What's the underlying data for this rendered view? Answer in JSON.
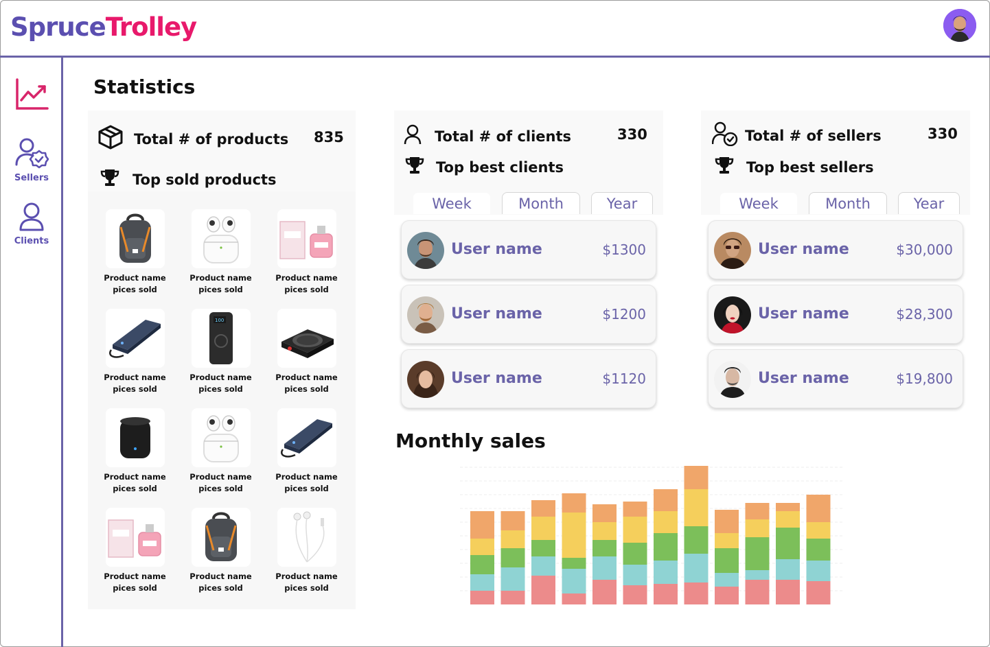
{
  "app": {
    "logo_part1": "Spruce",
    "logo_part2": "Trolley"
  },
  "sidebar": {
    "items": [
      {
        "label": "",
        "icon": "chart-line-icon"
      },
      {
        "label": "Sellers",
        "icon": "sellers-icon"
      },
      {
        "label": "Clients",
        "icon": "clients-icon"
      }
    ]
  },
  "page": {
    "title": "Statistics"
  },
  "products": {
    "total_label": "Total # of products",
    "total_value": "835",
    "top_label": "Top sold products",
    "items": [
      {
        "name": "Product name",
        "sold": "pices sold",
        "image": "backpack"
      },
      {
        "name": "Product name",
        "sold": "pices sold",
        "image": "earbuds"
      },
      {
        "name": "Product name",
        "sold": "pices sold",
        "image": "perfume"
      },
      {
        "name": "Product name",
        "sold": "pices sold",
        "image": "powerbank-slim"
      },
      {
        "name": "Product name",
        "sold": "pices sold",
        "image": "powerbank"
      },
      {
        "name": "Product name",
        "sold": "pices sold",
        "image": "hotplate"
      },
      {
        "name": "Product name",
        "sold": "pices sold",
        "image": "smart-hub"
      },
      {
        "name": "Product name",
        "sold": "pices sold",
        "image": "earbuds"
      },
      {
        "name": "Product name",
        "sold": "pices sold",
        "image": "powerbank-slim"
      },
      {
        "name": "Product name",
        "sold": "pices sold",
        "image": "perfume"
      },
      {
        "name": "Product name",
        "sold": "pices sold",
        "image": "backpack"
      },
      {
        "name": "Product name",
        "sold": "pices sold",
        "image": "earphones"
      }
    ]
  },
  "clients": {
    "total_label": "Total # of clients",
    "total_value": "330",
    "top_label": "Top best clients",
    "tabs": [
      "Week",
      "Month",
      "Year"
    ],
    "list": [
      {
        "name": "User name",
        "amount": "$1300"
      },
      {
        "name": "User name",
        "amount": "$1200"
      },
      {
        "name": "User name",
        "amount": "$1120"
      }
    ]
  },
  "sellers": {
    "total_label": "Total # of sellers",
    "total_value": "330",
    "top_label": "Top best sellers",
    "tabs": [
      "Week",
      "Month",
      "Year"
    ],
    "list": [
      {
        "name": "User name",
        "amount": "$30,000"
      },
      {
        "name": "User name",
        "amount": "$28,300"
      },
      {
        "name": "User name",
        "amount": "$19,800"
      }
    ]
  },
  "sales": {
    "title": "Monthly sales"
  },
  "colors": {
    "accent": "#6a63a8",
    "brand_pink": "#e8196b",
    "brand_purple": "#5b4fb0"
  },
  "chart_data": {
    "type": "bar",
    "stacked": true,
    "categories": [
      "",
      "",
      "",
      "",
      "",
      "",
      "",
      "",
      "",
      "",
      "",
      ""
    ],
    "series": [
      {
        "color": "#ec8b8b",
        "values": [
          20,
          20,
          42,
          16,
          36,
          28,
          30,
          32,
          26,
          36,
          36,
          34
        ]
      },
      {
        "color": "#8fd3d3",
        "values": [
          24,
          34,
          28,
          36,
          34,
          30,
          34,
          42,
          20,
          14,
          30,
          30
        ]
      },
      {
        "color": "#7cbf5a",
        "values": [
          28,
          28,
          24,
          16,
          24,
          32,
          40,
          40,
          36,
          48,
          46,
          32
        ]
      },
      {
        "color": "#f5cf5c",
        "values": [
          24,
          26,
          34,
          66,
          26,
          38,
          32,
          54,
          22,
          26,
          24,
          24
        ]
      },
      {
        "color": "#f0a66a",
        "values": [
          40,
          28,
          24,
          28,
          26,
          22,
          32,
          34,
          34,
          24,
          12,
          40
        ]
      }
    ],
    "ylim": [
      0,
      200
    ],
    "grid": true,
    "title": "",
    "xlabel": "",
    "ylabel": ""
  }
}
